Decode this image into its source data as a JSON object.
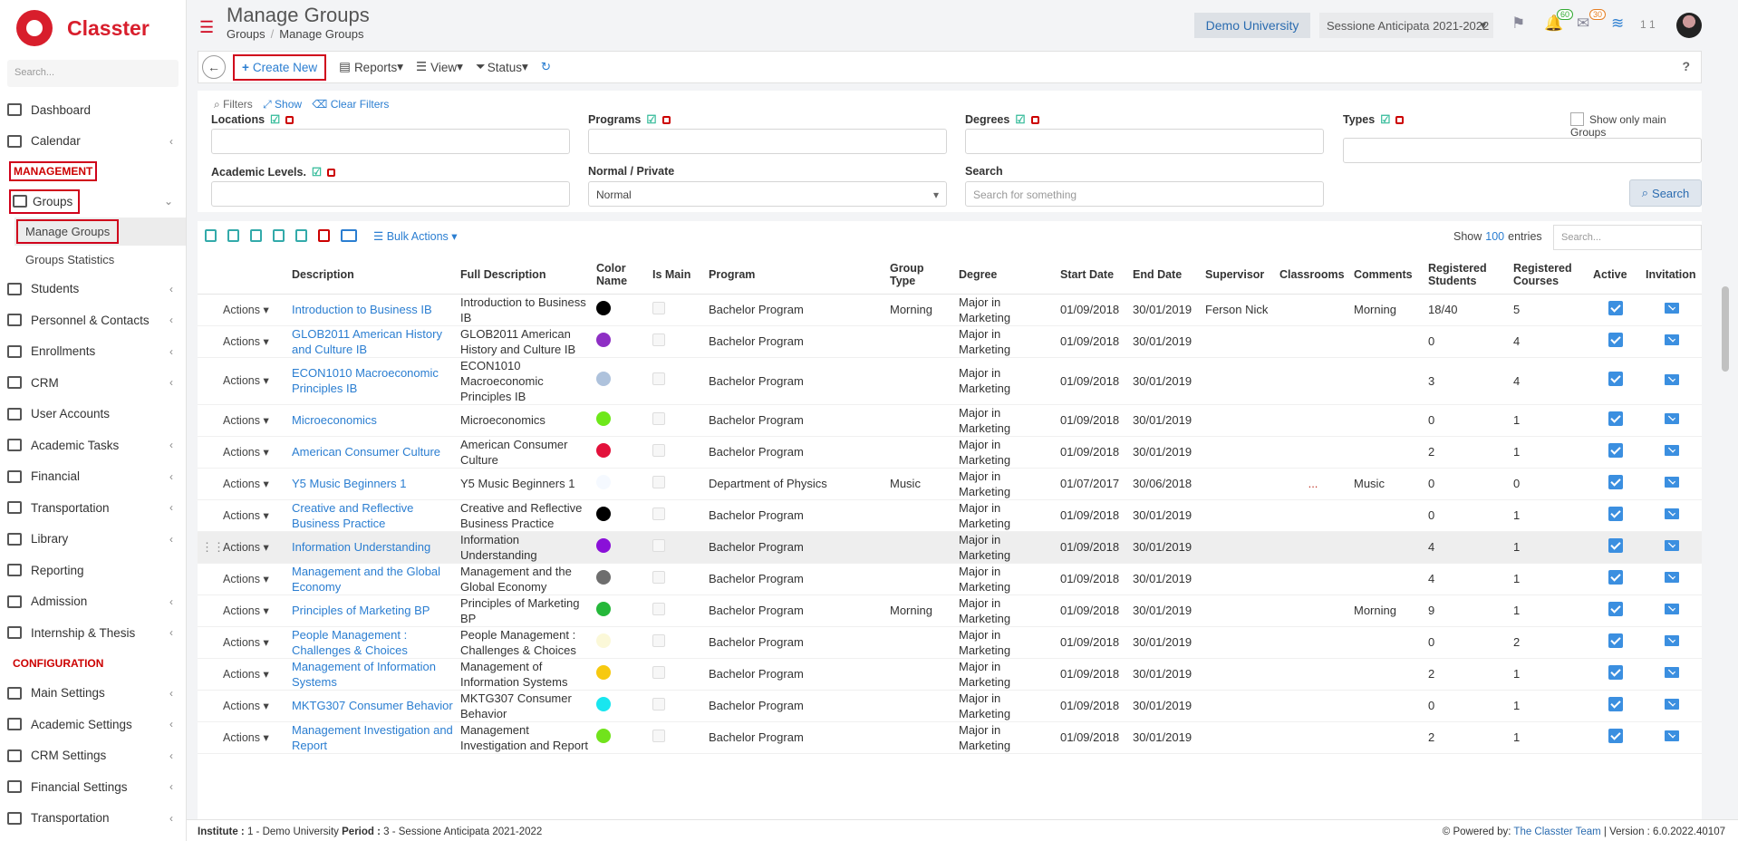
{
  "app": {
    "logo_text": "Classter",
    "search_placeholder": "Search..."
  },
  "sidebar": {
    "items_top": [
      {
        "label": "Dashboard",
        "icon": "monitor-icon",
        "chevron": false
      },
      {
        "label": "Calendar",
        "icon": "calendar-icon",
        "chevron": true
      }
    ],
    "management_label": "MANAGEMENT",
    "groups_label": "Groups",
    "groups_sub": [
      "Manage Groups",
      "Groups Statistics"
    ],
    "items_mid": [
      {
        "label": "Students",
        "icon": "student-icon",
        "chevron": true
      },
      {
        "label": "Personnel & Contacts",
        "icon": "person-icon",
        "chevron": true
      },
      {
        "label": "Enrollments",
        "icon": "arrows-icon",
        "chevron": true
      },
      {
        "label": "CRM",
        "icon": "shuffle-icon",
        "chevron": true
      },
      {
        "label": "User Accounts",
        "icon": "key-icon",
        "chevron": false
      },
      {
        "label": "Academic Tasks",
        "icon": "grid-icon",
        "chevron": true
      },
      {
        "label": "Financial",
        "icon": "coins-icon",
        "chevron": true
      },
      {
        "label": "Transportation",
        "icon": "bus-icon",
        "chevron": true
      },
      {
        "label": "Library",
        "icon": "books-icon",
        "chevron": true
      },
      {
        "label": "Reporting",
        "icon": "printer-icon",
        "chevron": false
      },
      {
        "label": "Admission",
        "icon": "bank-icon",
        "chevron": true
      },
      {
        "label": "Internship & Thesis",
        "icon": "cube-icon",
        "chevron": true
      }
    ],
    "configuration_label": "CONFIGURATION",
    "items_conf": [
      {
        "label": "Main Settings",
        "icon": "sliders-icon",
        "chevron": true
      },
      {
        "label": "Academic Settings",
        "icon": "people-icon",
        "chevron": true
      },
      {
        "label": "CRM Settings",
        "icon": "shuffle-icon",
        "chevron": true
      },
      {
        "label": "Financial Settings",
        "icon": "coins-icon",
        "chevron": true
      },
      {
        "label": "Transportation",
        "icon": "bus-icon",
        "chevron": true
      }
    ]
  },
  "header": {
    "title": "Manage Groups",
    "breadcrumb": [
      "Groups",
      "Manage Groups"
    ],
    "institute": "Demo University",
    "period": "Sessione Anticipata 2021-2022",
    "notifications_count": "60",
    "messages_count": "30",
    "user_short": "1 1"
  },
  "toolbar": {
    "create_label": "Create New",
    "reports_label": "Reports",
    "view_label": "View",
    "status_label": "Status",
    "help_label": "?"
  },
  "filters": {
    "title": "Filters",
    "show_label": "Show",
    "clear_label": "Clear Filters",
    "locations_label": "Locations",
    "programs_label": "Programs",
    "degrees_label": "Degrees",
    "types_label": "Types",
    "main_groups_label": "Show only main Groups",
    "academic_levels_label": "Academic Levels.",
    "normal_private_label": "Normal / Private",
    "normal_private_value": "Normal",
    "search_label": "Search",
    "search_placeholder": "Search for something",
    "search_button": "Search"
  },
  "table_tools": {
    "bulk_label": "Bulk Actions",
    "show_label": "Show",
    "show_count": "100",
    "entries_label": "entries",
    "search_placeholder": "Search..."
  },
  "table": {
    "headers": [
      "Description",
      "Full Description",
      "Color Name",
      "Is Main",
      "Program",
      "Group Type",
      "Degree",
      "Start Date",
      "End Date",
      "Supervisor",
      "Classrooms",
      "Comments",
      "Registered Students",
      "Registered Courses",
      "Active",
      "Invitation"
    ],
    "actions_label": "Actions",
    "rows": [
      {
        "desc": "Introduction to Business IB",
        "full": "Introduction to Business IB",
        "color": "#000000",
        "program": "Bachelor Program",
        "type": "Morning",
        "degree": "Major in Marketing",
        "start": "01/09/2018",
        "end": "30/01/2019",
        "supervisor": "Ferson Nick",
        "classrooms": "",
        "comments": "Morning",
        "students": "18/40",
        "courses": "5",
        "hl": false
      },
      {
        "desc": "GLOB2011 American History and Culture IB",
        "full": "GLOB2011 American History and Culture IB",
        "color": "#8e2fc4",
        "program": "Bachelor Program",
        "type": "",
        "degree": "Major in Marketing",
        "start": "01/09/2018",
        "end": "30/01/2019",
        "supervisor": "",
        "classrooms": "",
        "comments": "",
        "students": "0",
        "courses": "4",
        "hl": false
      },
      {
        "desc": "ECON1010 Macroeconomic Principles IB",
        "full": "ECON1010 Macroeconomic Principles IB",
        "color": "#aec2dc",
        "program": "Bachelor Program",
        "type": "",
        "degree": "Major in Marketing",
        "start": "01/09/2018",
        "end": "30/01/2019",
        "supervisor": "",
        "classrooms": "",
        "comments": "",
        "students": "3",
        "courses": "4",
        "hl": false
      },
      {
        "desc": "Microeconomics",
        "full": "Microeconomics",
        "color": "#6ee81a",
        "program": "Bachelor Program",
        "type": "",
        "degree": "Major in Marketing",
        "start": "01/09/2018",
        "end": "30/01/2019",
        "supervisor": "",
        "classrooms": "",
        "comments": "",
        "students": "0",
        "courses": "1",
        "hl": false
      },
      {
        "desc": "American Consumer Culture",
        "full": "American Consumer Culture",
        "color": "#e3113b",
        "program": "Bachelor Program",
        "type": "",
        "degree": "Major in Marketing",
        "start": "01/09/2018",
        "end": "30/01/2019",
        "supervisor": "",
        "classrooms": "",
        "comments": "",
        "students": "2",
        "courses": "1",
        "hl": false
      },
      {
        "desc": "Y5 Music Beginners 1",
        "full": "Y5 Music Beginners 1",
        "color": "#f5f9ff",
        "program": "Department of Physics",
        "type": "Music",
        "degree": "Major in Marketing",
        "start": "01/07/2017",
        "end": "30/06/2018",
        "supervisor": "",
        "classrooms": "...",
        "comments": "Music",
        "students": "0",
        "courses": "0",
        "hl": false
      },
      {
        "desc": "Creative and Reflective Business Practice",
        "full": "Creative and Reflective Business Practice",
        "color": "#000000",
        "program": "Bachelor Program",
        "type": "",
        "degree": "Major in Marketing",
        "start": "01/09/2018",
        "end": "30/01/2019",
        "supervisor": "",
        "classrooms": "",
        "comments": "",
        "students": "0",
        "courses": "1",
        "hl": false
      },
      {
        "desc": "Information Understanding",
        "full": "Information Understanding",
        "color": "#8a10d8",
        "program": "Bachelor Program",
        "type": "",
        "degree": "Major in Marketing",
        "start": "01/09/2018",
        "end": "30/01/2019",
        "supervisor": "",
        "classrooms": "",
        "comments": "",
        "students": "4",
        "courses": "1",
        "hl": true
      },
      {
        "desc": "Management and the Global Economy",
        "full": "Management and the Global Economy",
        "color": "#6e6e6e",
        "program": "Bachelor Program",
        "type": "",
        "degree": "Major in Marketing",
        "start": "01/09/2018",
        "end": "30/01/2019",
        "supervisor": "",
        "classrooms": "",
        "comments": "",
        "students": "4",
        "courses": "1",
        "hl": false
      },
      {
        "desc": "Principles of Marketing BP",
        "full": "Principles of Marketing BP",
        "color": "#25b83a",
        "program": "Bachelor Program",
        "type": "Morning",
        "degree": "Major in Marketing",
        "start": "01/09/2018",
        "end": "30/01/2019",
        "supervisor": "",
        "classrooms": "",
        "comments": "Morning",
        "students": "9",
        "courses": "1",
        "hl": false
      },
      {
        "desc": "People Management : Challenges & Choices",
        "full": "People Management : Challenges & Choices",
        "color": "#fbf8d8",
        "program": "Bachelor Program",
        "type": "",
        "degree": "Major in Marketing",
        "start": "01/09/2018",
        "end": "30/01/2019",
        "supervisor": "",
        "classrooms": "",
        "comments": "",
        "students": "0",
        "courses": "2",
        "hl": false
      },
      {
        "desc": "Management of Information Systems",
        "full": "Management of Information Systems",
        "color": "#f7c90f",
        "program": "Bachelor Program",
        "type": "",
        "degree": "Major in Marketing",
        "start": "01/09/2018",
        "end": "30/01/2019",
        "supervisor": "",
        "classrooms": "",
        "comments": "",
        "students": "2",
        "courses": "1",
        "hl": false
      },
      {
        "desc": "MKTG307 Consumer Behavior",
        "full": "MKTG307 Consumer Behavior",
        "color": "#19e6ef",
        "program": "Bachelor Program",
        "type": "",
        "degree": "Major in Marketing",
        "start": "01/09/2018",
        "end": "30/01/2019",
        "supervisor": "",
        "classrooms": "",
        "comments": "",
        "students": "0",
        "courses": "1",
        "hl": false
      },
      {
        "desc": "Management Investigation and Report",
        "full": "Management Investigation and Report",
        "color": "#71e31c",
        "program": "Bachelor Program",
        "type": "",
        "degree": "Major in Marketing",
        "start": "01/09/2018",
        "end": "30/01/2019",
        "supervisor": "",
        "classrooms": "",
        "comments": "",
        "students": "2",
        "courses": "1",
        "hl": false
      }
    ]
  },
  "footer": {
    "institute_label": "Institute :",
    "institute_value": "1 - Demo University",
    "period_label": "Period :",
    "period_value": "3 - Sessione Anticipata 2021-2022",
    "powered_label": "Powered by:",
    "powered_team": "The Classter Team",
    "version": "| Version : 6.0.2022.40107"
  }
}
